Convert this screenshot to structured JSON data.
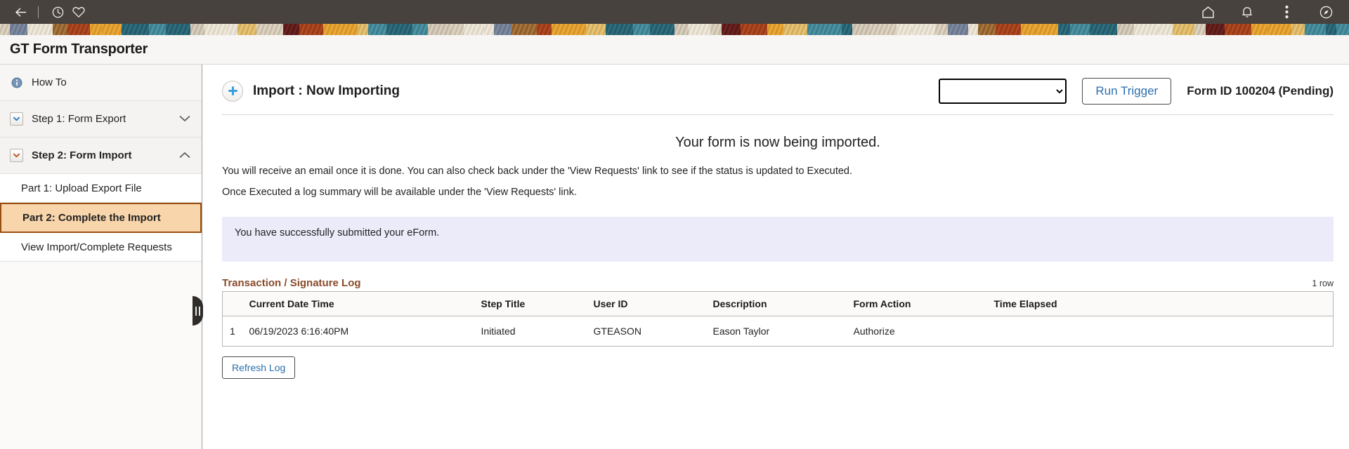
{
  "topbar": {
    "back_icon": "back-arrow-icon",
    "recents_icon": "clock-icon",
    "favorites_icon": "heart-icon",
    "home_icon": "home-icon",
    "notifications_icon": "bell-icon",
    "actions_icon": "kebab-menu-icon",
    "navigator_icon": "compass-icon",
    "background_color": "#48423e"
  },
  "page": {
    "title": "GT Form Transporter"
  },
  "sidebar": {
    "items": [
      {
        "label": "How To",
        "type": "info",
        "icon": "info-circle-icon",
        "bold": false
      },
      {
        "label": "Step 1: Form Export",
        "type": "group",
        "icon": "chevron-square-icon",
        "chevron": "∨",
        "bold": false
      },
      {
        "label": "Step 2: Form Import",
        "type": "group",
        "icon": "chevron-square-icon",
        "chevron": "∧",
        "bold": true
      }
    ],
    "sub_items": [
      {
        "label": "Part 1: Upload Export File",
        "active": false
      },
      {
        "label": "Part 2: Complete the Import",
        "active": true
      },
      {
        "label": "View Import/Complete Requests",
        "active": false
      }
    ],
    "splitter_name": "sidebar-splitter-handle",
    "active_color": "#f8d5ab",
    "active_border_color": "#9a4f12"
  },
  "main": {
    "add_icon": "plus-circle-icon",
    "header_title": "Import :  Now Importing",
    "trigger_select_value": "",
    "trigger_select_options": [
      ""
    ],
    "run_trigger_label": "Run Trigger",
    "form_id_label": "Form ID 100204 (Pending)",
    "heading": "Your form is now being imported.",
    "paragraph_1": "You will receive an email once it is done. You can also check back under the 'View Requests' link to see if the status is updated to Executed.",
    "paragraph_2": "Once Executed a log summary will be available under the 'View Requests' link.",
    "success_message": "You have successfully submitted your eForm.",
    "success_box_color": "#ecebfa"
  },
  "log": {
    "title": "Transaction / Signature Log",
    "title_color": "#8a4b2a",
    "row_count": "1 row",
    "columns": [
      "",
      "Current Date Time",
      "Step Title",
      "User ID",
      "Description",
      "Form Action",
      "Time Elapsed"
    ],
    "rows": [
      {
        "index": "1",
        "date_time": "06/19/2023  6:16:40PM",
        "step_title": "Initiated",
        "user_id": "GTEASON",
        "description": "Eason Taylor",
        "form_action": "Authorize",
        "time_elapsed": ""
      }
    ],
    "refresh_label": "Refresh Log"
  }
}
